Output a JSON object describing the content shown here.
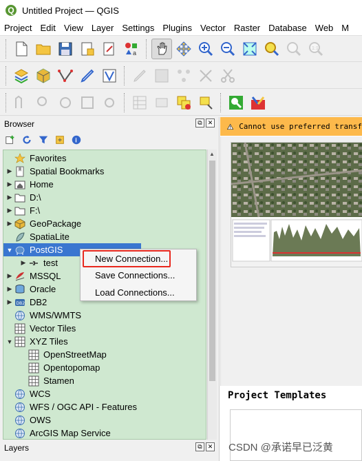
{
  "window": {
    "title": "Untitled Project — QGIS",
    "logo_letter": "Q"
  },
  "menubar": [
    "Project",
    "Edit",
    "View",
    "Layer",
    "Settings",
    "Plugins",
    "Vector",
    "Raster",
    "Database",
    "Web",
    "M"
  ],
  "toolbar_icons": {
    "row1": [
      "new-project-icon",
      "open-project-icon",
      "save-project-icon",
      "new-print-layout-icon",
      "show-layout-manager-icon",
      "style-manager-icon",
      "pan-map-icon",
      "pan-to-selection-icon",
      "zoom-in-icon",
      "zoom-out-icon",
      "zoom-full-icon",
      "zoom-to-selection-icon",
      "zoom-to-layer-icon",
      "zoom-to-native-resolution-icon"
    ],
    "row2": [
      "data-source-manager-icon",
      "new-geopackage-layer-icon",
      "digitize-icon",
      "current-edits-icon",
      "vertex-tool-icon",
      "toggle-editing-icon",
      "save-edits-icon",
      "add-feature-icon",
      "delete-selected-icon",
      "cut-features-icon"
    ],
    "row3": [
      "identify-icon",
      "select-features-icon",
      "deselect-icon",
      "select-by-value-icon",
      "field-calculator-icon",
      "attribute-table-icon",
      "remove-selection-icon",
      "label-pin-icon",
      "python-console-icon",
      "processing-toolbox-icon"
    ]
  },
  "browser": {
    "title": "Browser",
    "float_btn": "⧉",
    "close_btn": "✕",
    "tools": [
      "add-selected-layers-icon",
      "refresh-icon",
      "filter-icon",
      "collapse-all-icon",
      "info-icon"
    ],
    "items": [
      {
        "label": "Favorites",
        "icon": "star-icon",
        "arrow": ""
      },
      {
        "label": "Spatial Bookmarks",
        "icon": "bookmark-icon",
        "arrow": "▶"
      },
      {
        "label": "Home",
        "icon": "home-folder-icon",
        "arrow": "▶"
      },
      {
        "label": "D:\\",
        "icon": "drive-folder-icon",
        "arrow": "▶"
      },
      {
        "label": "F:\\",
        "icon": "drive-folder-icon",
        "arrow": "▶"
      },
      {
        "label": "GeoPackage",
        "icon": "geopackage-icon",
        "arrow": "▶"
      },
      {
        "label": "SpatiaLite",
        "icon": "spatialite-icon",
        "arrow": ""
      },
      {
        "label": "PostGIS",
        "icon": "postgis-elephant-icon",
        "arrow": "▼",
        "selected": true
      },
      {
        "label": "test",
        "icon": "connection-icon",
        "arrow": "▶",
        "indent": 1
      },
      {
        "label": "MSSQL",
        "icon": "mssql-icon",
        "arrow": "▶"
      },
      {
        "label": "Oracle",
        "icon": "oracle-icon",
        "arrow": "▶"
      },
      {
        "label": "DB2",
        "icon": "db2-icon",
        "arrow": "▶"
      },
      {
        "label": "WMS/WMTS",
        "icon": "globe-icon",
        "arrow": ""
      },
      {
        "label": "Vector Tiles",
        "icon": "grid-icon",
        "arrow": ""
      },
      {
        "label": "XYZ Tiles",
        "icon": "grid-icon",
        "arrow": "▼"
      },
      {
        "label": "OpenStreetMap",
        "icon": "grid-icon",
        "arrow": "",
        "indent": 1
      },
      {
        "label": "Opentopomap",
        "icon": "grid-icon",
        "arrow": "",
        "indent": 1
      },
      {
        "label": "Stamen",
        "icon": "grid-icon",
        "arrow": "",
        "indent": 1
      },
      {
        "label": "WCS",
        "icon": "globe-icon",
        "arrow": ""
      },
      {
        "label": "WFS / OGC API - Features",
        "icon": "globe-icon",
        "arrow": ""
      },
      {
        "label": "OWS",
        "icon": "globe-icon",
        "arrow": ""
      },
      {
        "label": "ArcGIS Map Service",
        "icon": "globe-icon",
        "arrow": ""
      }
    ]
  },
  "context_menu": {
    "items": [
      "New Connection...",
      "Save Connections...",
      "Load Connections..."
    ],
    "highlighted": "New Connection..."
  },
  "layers": {
    "title": "Layers"
  },
  "welcome": {
    "warning": "Cannot use preferred transf",
    "project_templates_title": "Project Templates"
  },
  "watermark": "CSDN @承诺早已泛黄",
  "colors": {
    "tree_bg": "#cfe8d0",
    "selection": "#3a76d0",
    "warning_bg": "#fdb94b",
    "highlight_box": "#e8281e"
  }
}
